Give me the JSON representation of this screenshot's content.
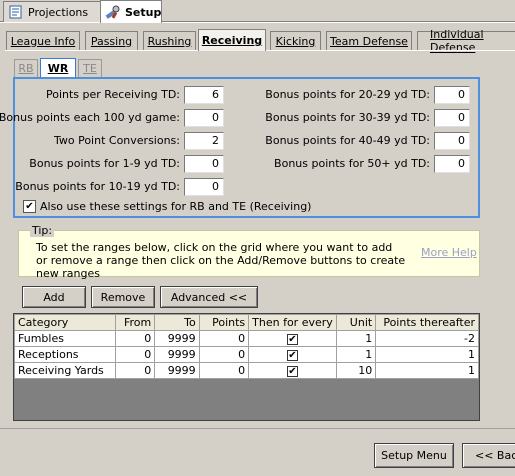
{
  "window_tabs": [
    {
      "label": "Projections",
      "icon": "document-icon",
      "active": false
    },
    {
      "label": "Setup",
      "icon": "tools-icon",
      "active": true
    }
  ],
  "section_tabs": [
    {
      "label": "League Info"
    },
    {
      "label": "Passing"
    },
    {
      "label": "Rushing"
    },
    {
      "label": "Receiving",
      "active": true
    },
    {
      "label": "Kicking"
    },
    {
      "label": "Team Defense"
    },
    {
      "label": "Individual Defense"
    }
  ],
  "position_tabs": [
    {
      "label": "RB"
    },
    {
      "label": "WR",
      "active": true
    },
    {
      "label": "TE"
    }
  ],
  "settings": {
    "left": [
      {
        "label": "Points per Receiving TD:",
        "value": "6"
      },
      {
        "label": "Bonus points each 100 yd game:",
        "value": "0"
      },
      {
        "label": "Two Point Conversions:",
        "value": "2"
      },
      {
        "label": "Bonus points for 1-9 yd TD:",
        "value": "0"
      },
      {
        "label": "Bonus points for 10-19 yd TD:",
        "value": "0"
      }
    ],
    "right": [
      {
        "label": "Bonus points for 20-29 yd TD:",
        "value": "0"
      },
      {
        "label": "Bonus points for 30-39 yd TD:",
        "value": "0"
      },
      {
        "label": "Bonus points for 40-49 yd TD:",
        "value": "0"
      },
      {
        "label": "Bonus points for 50+ yd TD:",
        "value": "0"
      }
    ],
    "also_use_label": "Also use these settings for RB and TE (Receiving)",
    "also_use_checked": true
  },
  "tip": {
    "title": "Tip:",
    "text": "To set the ranges below, click on the grid where you want to add or remove a range then click on the Add/Remove buttons to create new ranges",
    "more_help": "More Help"
  },
  "buttons": {
    "add": "Add",
    "remove": "Remove",
    "advanced": "Advanced <<",
    "setup_menu": "Setup Menu",
    "back": "<< Bac"
  },
  "grid": {
    "columns": [
      "Category",
      "From",
      "To",
      "Points",
      "Then for every",
      "Unit",
      "Points thereafter"
    ],
    "rows": [
      {
        "category": "Fumbles",
        "from": "0",
        "to": "9999",
        "points": "0",
        "then_for_every": true,
        "unit": "1",
        "thereafter": "-2"
      },
      {
        "category": "Receptions",
        "from": "0",
        "to": "9999",
        "points": "0",
        "then_for_every": true,
        "unit": "1",
        "thereafter": "1"
      },
      {
        "category": "Receiving Yards",
        "from": "0",
        "to": "9999",
        "points": "0",
        "then_for_every": true,
        "unit": "10",
        "thereafter": "1"
      }
    ]
  },
  "colors": {
    "accent": "#4f8fe0",
    "tip_background": "#ffffe1",
    "window_background": "#d4d0c8"
  }
}
